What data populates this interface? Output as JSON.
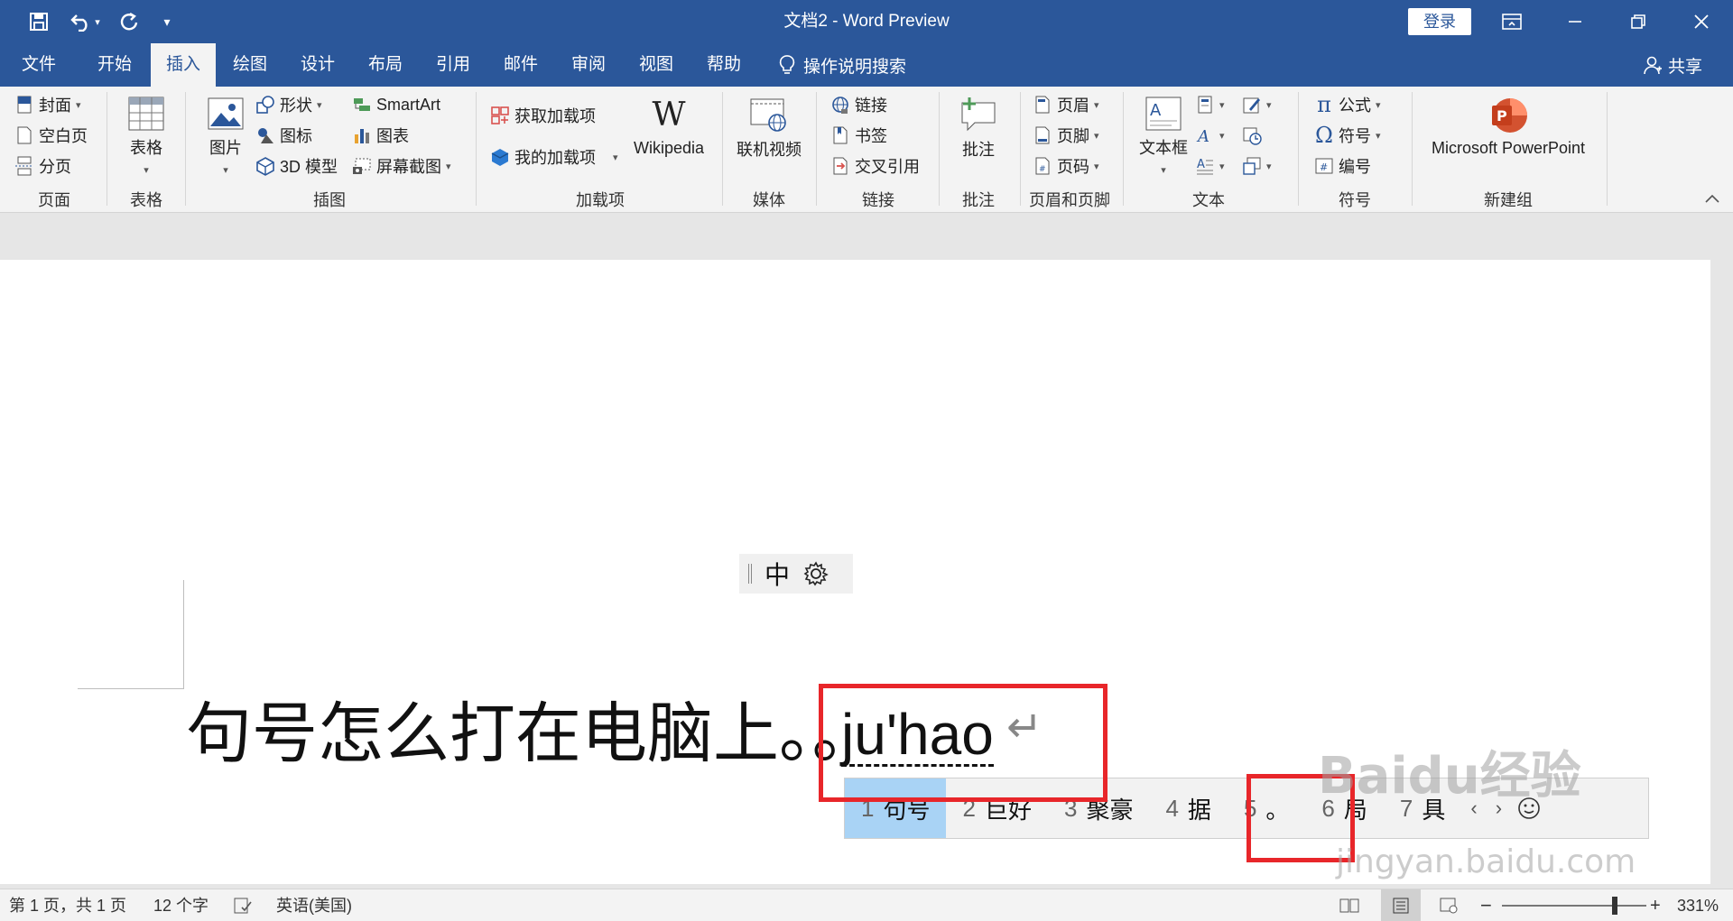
{
  "window": {
    "title": "文档2  -  Word Preview",
    "login": "登录"
  },
  "quick_access": {
    "save": "save-icon",
    "undo": "undo-icon",
    "redo": "redo-icon",
    "customize": "more-icon"
  },
  "tabs": [
    "文件",
    "开始",
    "插入",
    "绘图",
    "设计",
    "布局",
    "引用",
    "邮件",
    "审阅",
    "视图",
    "帮助"
  ],
  "active_tab": "插入",
  "tell_me": "操作说明搜索",
  "share": "共享",
  "ribbon": {
    "page_group": {
      "label": "页面",
      "items": [
        "封面",
        "空白页",
        "分页"
      ]
    },
    "table_group": {
      "label": "表格",
      "table": "表格"
    },
    "illustrations": {
      "label": "插图",
      "picture": "图片",
      "shapes": "形状",
      "icons": "图标",
      "model3d": "3D 模型",
      "smartart": "SmartArt",
      "chart": "图表",
      "screenshot": "屏幕截图"
    },
    "addins": {
      "label": "加载项",
      "get": "获取加载项",
      "my": "我的加载项",
      "wikipedia": "Wikipedia"
    },
    "media": {
      "label": "媒体",
      "online_video": "联机视频"
    },
    "links": {
      "label": "链接",
      "link": "链接",
      "bookmark": "书签",
      "crossref": "交叉引用"
    },
    "comments": {
      "label": "批注",
      "comment": "批注"
    },
    "header_footer": {
      "label": "页眉和页脚",
      "header": "页眉",
      "footer": "页脚",
      "page_number": "页码"
    },
    "text": {
      "label": "文本",
      "textbox": "文本框"
    },
    "symbols": {
      "label": "符号",
      "equation": "公式",
      "symbol": "符号",
      "number": "编号"
    },
    "new_group": {
      "label": "新建组",
      "ppt": "Microsoft PowerPoint"
    }
  },
  "document": {
    "text": "句号怎么打在电脑上。。",
    "composition": "ju'hao"
  },
  "ime": {
    "mode": "中"
  },
  "candidates": [
    {
      "num": "1",
      "text": "句号",
      "selected": true
    },
    {
      "num": "2",
      "text": "巨好",
      "selected": false
    },
    {
      "num": "3",
      "text": "聚豪",
      "selected": false
    },
    {
      "num": "4",
      "text": "据",
      "selected": false
    },
    {
      "num": "5",
      "text": "。",
      "selected": false
    },
    {
      "num": "6",
      "text": "局",
      "selected": false
    },
    {
      "num": "7",
      "text": "具",
      "selected": false
    }
  ],
  "status": {
    "page": "第 1 页，共 1 页",
    "words": "12 个字",
    "language": "英语(美国)",
    "zoom": "331%"
  },
  "watermark": {
    "brand": "Baidu经验",
    "url": "jingyan.baidu.com"
  },
  "colors": {
    "brand": "#2b579a",
    "highlight": "#e8262a",
    "candidate_selected": "#a9d3f5"
  }
}
